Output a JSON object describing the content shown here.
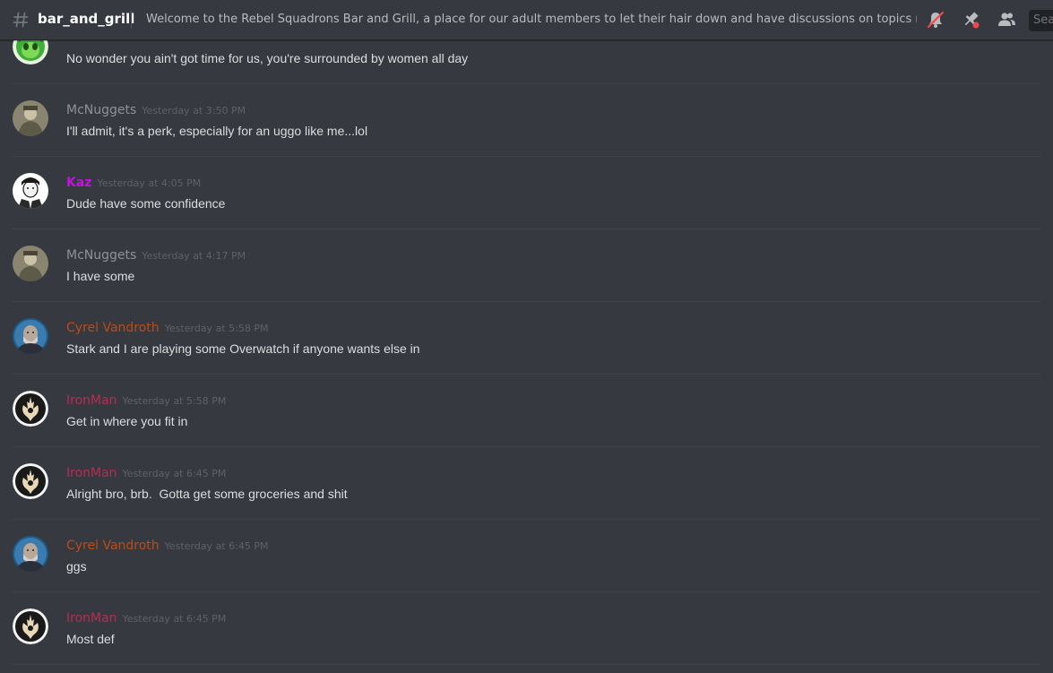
{
  "header": {
    "channel_name": "bar_and_grill",
    "topic": "Welcome to the Rebel Squadrons Bar and Grill, a place for our adult members to let their hair down and have discussions on topics not neccessarill...",
    "search_placeholder": "Sea",
    "icons": [
      "hash-icon",
      "mute-bell-icon",
      "pin-icon",
      "members-icon"
    ],
    "mute_color": "#f04747",
    "pin_badge_color": "#f04747"
  },
  "messages": [
    {
      "author": "",
      "author_color": "#b62d52",
      "timestamp": "",
      "text": "No wonder you ain't got time for us, you're surrounded by women all day",
      "avatar": "green-alien-avatar"
    },
    {
      "author": "McNuggets",
      "author_color": "#8e9297",
      "timestamp": "Yesterday at 3:50 PM",
      "text": "I'll admit, it's a perk, especially for an uggo like me...lol",
      "avatar": "vintage-photo-avatar"
    },
    {
      "author": "Kaz",
      "author_color": "#c413e0",
      "timestamp": "Yesterday at 4:05 PM",
      "text": "Dude have some confidence",
      "avatar": "cartoon-man-avatar"
    },
    {
      "author": "McNuggets",
      "author_color": "#8e9297",
      "timestamp": "Yesterday at 4:17 PM",
      "text": "I have some",
      "avatar": "vintage-photo-avatar"
    },
    {
      "author": "Cyrel Vandroth",
      "author_color": "#bb4c17",
      "timestamp": "Yesterday at 5:58 PM",
      "text": "Stark and I are playing some Overwatch if anyone wants else in",
      "avatar": "armored-figure-avatar"
    },
    {
      "author": "IronMan",
      "author_color": "#b62d52",
      "timestamp": "Yesterday at 5:58 PM",
      "text": "Get in where you fit in",
      "avatar": "rebel-emblem-avatar"
    },
    {
      "author": "IronMan",
      "author_color": "#b62d52",
      "timestamp": "Yesterday at 6:45 PM",
      "text": "Alright bro, brb.  Gotta get some groceries and shit",
      "avatar": "rebel-emblem-avatar"
    },
    {
      "author": "Cyrel Vandroth",
      "author_color": "#bb4c17",
      "timestamp": "Yesterday at 6:45 PM",
      "text": "ggs",
      "avatar": "armored-figure-avatar"
    },
    {
      "author": "IronMan",
      "author_color": "#b62d52",
      "timestamp": "Yesterday at 6:45 PM",
      "text": "Most def",
      "avatar": "rebel-emblem-avatar"
    }
  ]
}
